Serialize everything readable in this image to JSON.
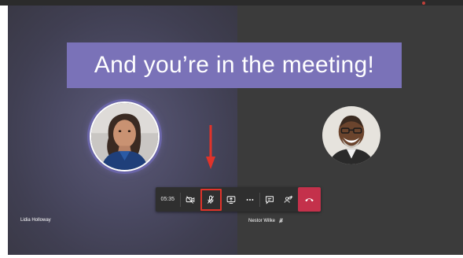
{
  "meeting": {
    "banner_text": "And you’re in the meeting!",
    "participants": [
      {
        "name": "Lidia Holloway",
        "avatar": "photo-woman",
        "muted": false
      },
      {
        "name": "Nestor Wilke",
        "avatar": "photo-man",
        "muted": true
      }
    ]
  },
  "toolbar": {
    "timer": "05:35",
    "buttons": [
      {
        "name": "camera-off",
        "icon": "video-off-icon"
      },
      {
        "name": "microphone-muted",
        "icon": "mic-off-icon",
        "highlighted": true
      },
      {
        "name": "share-screen",
        "icon": "share-screen-icon"
      },
      {
        "name": "more-actions",
        "icon": "ellipsis-icon"
      },
      {
        "name": "show-conversation",
        "icon": "chat-icon"
      },
      {
        "name": "show-participants",
        "icon": "people-add-icon"
      },
      {
        "name": "hang-up",
        "icon": "phone-hangup-icon"
      }
    ]
  },
  "annotation": {
    "icon": "red-arrow-down",
    "color": "#e0332a"
  },
  "colors": {
    "banner": "#7a72b8",
    "hangup": "#c4314b",
    "stage": "#3b3a3a"
  }
}
